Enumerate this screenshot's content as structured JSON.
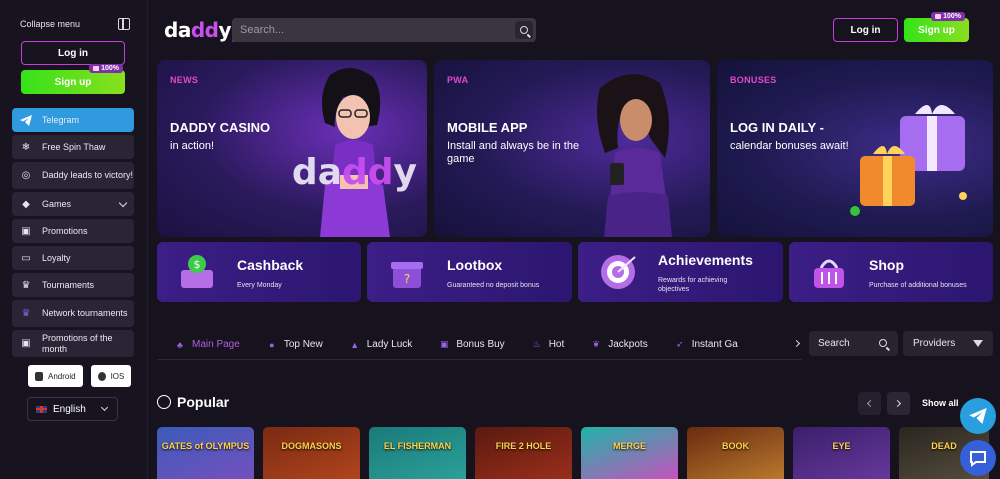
{
  "sidebar": {
    "collapse_label": "Collapse menu",
    "login_label": "Log in",
    "signup_label": "Sign up",
    "signup_badge": "100%",
    "items": [
      {
        "label": "Telegram",
        "icon": "telegram-icon"
      },
      {
        "label": "Free Spin Thaw",
        "icon": "snowflake-icon"
      },
      {
        "label": "Daddy leads to victory!",
        "icon": "target-icon"
      },
      {
        "label": "Games",
        "icon": "diamond-icon"
      },
      {
        "label": "Promotions",
        "icon": "gift-icon"
      },
      {
        "label": "Loyalty",
        "icon": "card-icon"
      },
      {
        "label": "Tournaments",
        "icon": "trophy-icon"
      },
      {
        "label": "Network tournaments",
        "icon": "trophy-network-icon"
      },
      {
        "label": "Promotions of the month",
        "icon": "gift-month-icon"
      }
    ],
    "android_label": "Android",
    "ios_label": "IOS",
    "language": "English"
  },
  "header": {
    "logo_text_a": "da",
    "logo_text_b": "dd",
    "logo_text_c": "y",
    "search_placeholder": "Search...",
    "login_label": "Log in",
    "signup_label": "Sign up",
    "signup_badge": "100%"
  },
  "banners": [
    {
      "tag": "NEWS",
      "title": "DADDY CASINO",
      "subtitle": "in action!"
    },
    {
      "tag": "PWA",
      "title": "MOBILE APP",
      "subtitle": "Install and always be in the game"
    },
    {
      "tag": "BONUSES",
      "title": "LOG IN DAILY -",
      "subtitle": "calendar bonuses await!"
    }
  ],
  "banner1_word": {
    "a": "da",
    "b": "dd",
    "c": "y"
  },
  "cards": [
    {
      "title": "Cashback",
      "subtitle": "Every Monday"
    },
    {
      "title": "Lootbox",
      "subtitle": "Guaranteed no deposit bonus"
    },
    {
      "title": "Achievements",
      "subtitle": "Rewards for achieving objectives"
    },
    {
      "title": "Shop",
      "subtitle": "Purchase of additional bonuses"
    }
  ],
  "tabs": [
    {
      "label": "Main Page",
      "active": true
    },
    {
      "label": "Top New"
    },
    {
      "label": "Lady Luck"
    },
    {
      "label": "Bonus Buy"
    },
    {
      "label": "Hot"
    },
    {
      "label": "Jackpots"
    },
    {
      "label": "Instant Ga"
    }
  ],
  "tab_search_label": "Search",
  "providers_label": "Providers",
  "popular": {
    "title": "Popular",
    "show_all": "Show all",
    "games": [
      {
        "title": "GATES of OLYMPUS",
        "color1": "#3b5bb8",
        "color2": "#7a4fc0"
      },
      {
        "title": "DOGMASONS",
        "color1": "#7a2a14",
        "color2": "#b5471c"
      },
      {
        "title": "EL FISHERMAN",
        "color1": "#1a7a7a",
        "color2": "#2da39b"
      },
      {
        "title": "FIRE 2 HOLE",
        "color1": "#5a1a10",
        "color2": "#a0301c"
      },
      {
        "title": "MERGE",
        "color1": "#1fb4a6",
        "color2": "#d44ac0"
      },
      {
        "title": "BOOK",
        "color1": "#6a2a10",
        "color2": "#c08030"
      },
      {
        "title": "EYE",
        "color1": "#3a1f6a",
        "color2": "#6a3aa0"
      },
      {
        "title": "DEAD",
        "color1": "#2a2620",
        "color2": "#5a5040"
      }
    ]
  },
  "colors": {
    "accent_pink": "#c73ddb",
    "signup_green": "#35e21a",
    "telegram_blue": "#2f9ae0",
    "card_purple": "#3c1e86",
    "tag_pink": "#e448c6",
    "active_tab": "#b35ee0"
  }
}
